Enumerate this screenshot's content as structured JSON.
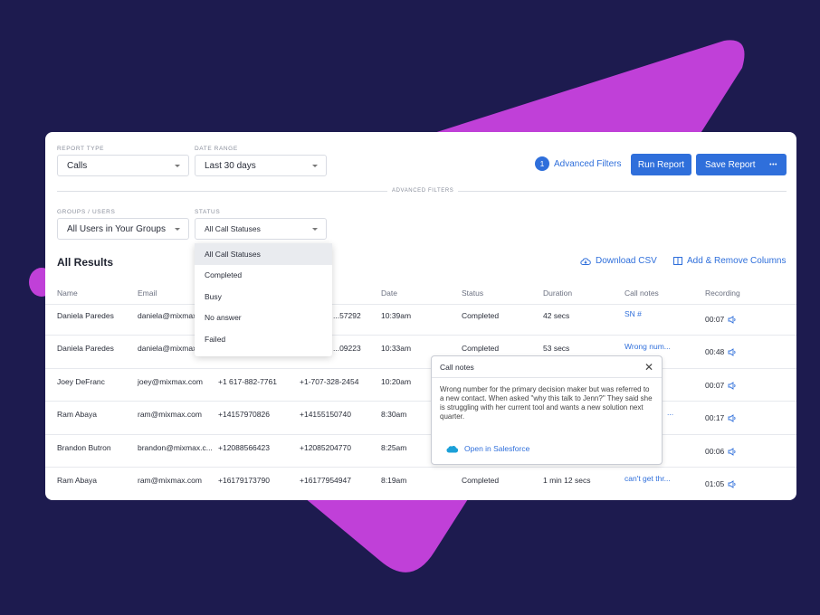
{
  "filters": {
    "report_type": {
      "label": "REPORT TYPE",
      "value": "Calls"
    },
    "date_range": {
      "label": "DATE RANGE",
      "value": "Last 30 days"
    },
    "advanced_count": "1",
    "advanced_filters_label": "Advanced Filters",
    "run_report": "Run Report",
    "save_report": "Save Report",
    "more": "•••",
    "advanced_divider": "ADVANCED FILTERS",
    "groups": {
      "label": "GROUPS / USERS",
      "value": "All Users in Your Groups"
    },
    "status": {
      "label": "STATUS",
      "value": "All Call Statuses"
    }
  },
  "status_options": [
    "All Call Statuses",
    "Completed",
    "Busy",
    "No answer",
    "Failed"
  ],
  "results": {
    "title": "All Results",
    "download_csv": "Download CSV",
    "columns_link": "Add & Remove Columns",
    "headers": [
      "Name",
      "Email",
      "",
      "",
      "Date",
      "Status",
      "Duration",
      "Call notes",
      "Recording"
    ],
    "rows": [
      {
        "name": "Daniela Paredes",
        "email": "daniela@mixmax.com",
        "from": "",
        "to": "...57292",
        "date": "10:39am",
        "status": "Completed",
        "duration": "42 secs",
        "notes": "SN #",
        "recording": "00:07"
      },
      {
        "name": "Daniela Paredes",
        "email": "daniela@mixmax",
        "from": "",
        "to": "...09223",
        "date": "10:33am",
        "status": "Completed",
        "duration": "53 secs",
        "notes": "Wrong num...",
        "recording": "00:48"
      },
      {
        "name": "Joey DeFranc",
        "email": "joey@mixmax.com",
        "from": "+1 617-882-7761",
        "to": "+1-707-328-2454",
        "date": "10:20am",
        "status": "",
        "duration": "",
        "notes": "",
        "recording": "00:07"
      },
      {
        "name": "Ram Abaya",
        "email": "ram@mixmax.com",
        "from": "+14157970826",
        "to": "+14155150740",
        "date": "8:30am",
        "status": "",
        "duration": "",
        "notes": "...",
        "recording": "00:17"
      },
      {
        "name": "Brandon Butron",
        "email": "brandon@mixmax.c...",
        "from": "+12088566423",
        "to": "+12085204770",
        "date": "8:25am",
        "status": "",
        "duration": "",
        "notes": "",
        "recording": "00:06"
      },
      {
        "name": "Ram Abaya",
        "email": "ram@mixmax.com",
        "from": "+16179173790",
        "to": "+16177954947",
        "date": "8:19am",
        "status": "Completed",
        "duration": "1 min 12 secs",
        "notes": "can't get thr...",
        "recording": "01:05"
      }
    ]
  },
  "popup": {
    "title": "Call notes",
    "body": "Wrong number for the primary decision maker but was referred to a new contact.  When asked \"why this talk to Jenn?\" They said she is struggling with her current tool and wants a new solution next quarter.",
    "link": "Open in Salesforce"
  },
  "colors": {
    "background": "#1d1b4f",
    "accent": "#c040d8",
    "primary": "#2f6fdb"
  }
}
